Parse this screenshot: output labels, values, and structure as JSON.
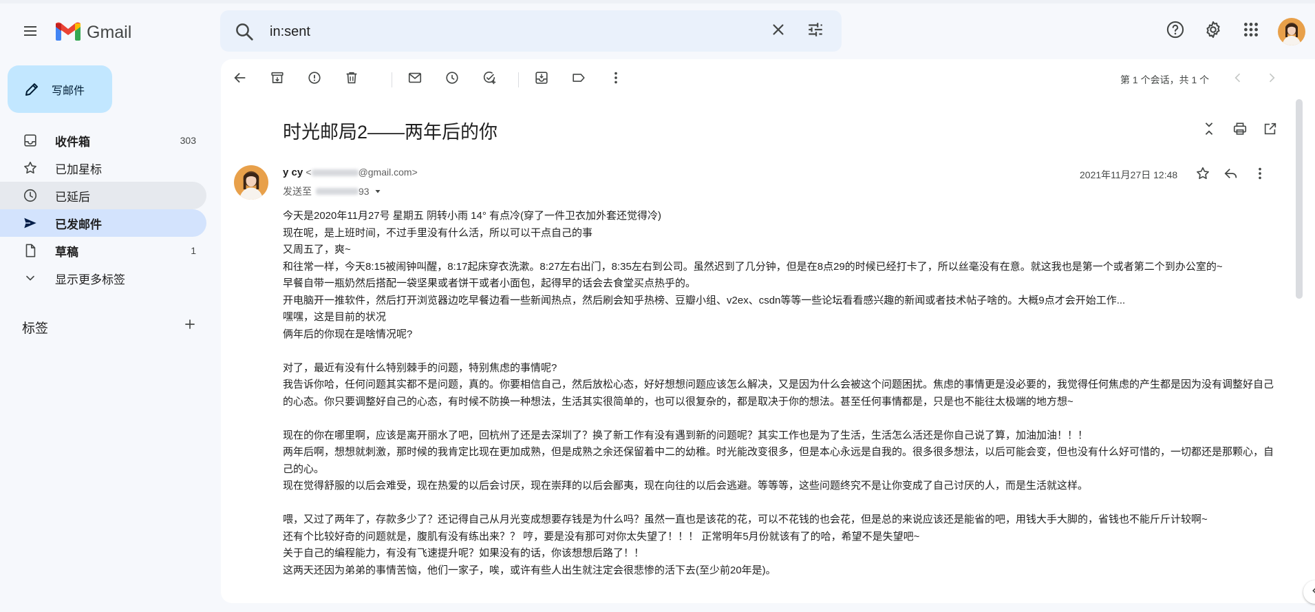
{
  "header": {
    "app_name": "Gmail",
    "search_value": "in:sent",
    "icons": [
      "menu-icon",
      "gmail-logo-icon",
      "search-icon",
      "close-icon",
      "tune-icon",
      "help-icon",
      "gear-icon",
      "apps-grid-icon",
      "avatar"
    ]
  },
  "sidebar": {
    "compose_label": "写邮件",
    "items": [
      {
        "label": "收件箱",
        "count": "303",
        "icon": "inbox-icon",
        "bold": true
      },
      {
        "label": "已加星标",
        "count": "",
        "icon": "star-icon"
      },
      {
        "label": "已延后",
        "count": "",
        "icon": "clock-icon"
      },
      {
        "label": "已发邮件",
        "count": "",
        "icon": "send-icon",
        "bold": true,
        "active": true
      },
      {
        "label": "草稿",
        "count": "1",
        "icon": "draft-icon",
        "bold": true
      },
      {
        "label": "显示更多标签",
        "count": "",
        "icon": "chevron-down-icon"
      }
    ],
    "labels_title": "标签"
  },
  "toolbar": {
    "pager_text": "第 1 个会话，共 1 个",
    "icons": [
      "back-arrow-icon",
      "archive-icon",
      "report-spam-icon",
      "delete-icon",
      "mark-unread-icon",
      "snooze-icon",
      "add-task-icon",
      "move-to-icon",
      "label-icon",
      "more-vert-icon",
      "chevron-left-icon",
      "chevron-right-icon"
    ]
  },
  "email": {
    "subject": "时光邮局2——两年后的你",
    "sender_name": "y cy",
    "sender_email_prefix": "<",
    "sender_email_suffix": "@gmail.com>",
    "to_prefix": "发送至",
    "to_suffix": "93",
    "date": "2021年11月27日 12:48",
    "body": [
      "今天是2020年11月27号  星期五  阴转小雨  14°  有点冷(穿了一件卫衣加外套还觉得冷)",
      "现在呢，是上班时间，不过手里没有什么活，所以可以干点自己的事",
      "又周五了，爽~",
      "和往常一样，今天8:15被闹钟叫醒，8:17起床穿衣洗漱。8:27左右出门，8:35左右到公司。虽然迟到了几分钟，但是在8点29的时候已经打卡了，所以丝毫没有在意。就这我也是第一个或者第二个到办公室的~",
      "早餐自带一瓶奶然后搭配一袋坚果或者饼干或者小面包，起得早的话会去食堂买点热乎的。",
      "开电脑开一推软件，然后打开浏览器边吃早餐边看一些新闻热点，然后刷会知乎热榜、豆瓣小组、v2ex、csdn等等一些论坛看看感兴趣的新闻或者技术帖子啥的。大概9点才会开始工作...",
      "嘿嘿，这是目前的状况",
      "俩年后的你现在是啥情况呢?",
      "",
      "对了，最近有没有什么特别棘手的问题，特别焦虑的事情呢?",
      "我告诉你哈，任何问题其实都不是问题，真的。你要相信自己，然后放松心态，好好想想问题应该怎么解决，又是因为什么会被这个问题困扰。焦虑的事情更是没必要的，我觉得任何焦虑的产生都是因为没有调整好自己的心态。你只要调整好自己的心态，有时候不防换一种想法，生活其实很简单的，也可以很复杂的，都是取决于你的想法。甚至任何事情都是，只是也不能往太极端的地方想~",
      "",
      "现在的你在哪里啊，应该是离开丽水了吧，回杭州了还是去深圳了？换了新工作有没有遇到新的问题呢？其实工作也是为了生活，生活怎么活还是你自己说了算，加油加油！！！",
      "两年后啊，想想就刺激，那时候的我肯定比现在更加成熟，但是成熟之余还保留着中二的幼稚。时光能改变很多，但是本心永远是自我的。很多很多想法，以后可能会变，但也没有什么好可惜的，一切都还是那颗心，自己的心。",
      "现在觉得舒服的以后会难受，现在热爱的以后会讨厌，现在崇拜的以后会鄙夷，现在向往的以后会逃避。等等等，这些问题终究不是让你变成了自己讨厌的人，而是生活就这样。",
      "",
      "喂，又过了两年了，存款多少了？还记得自己从月光变成想要存钱是为什么吗？虽然一直也是该花的花，可以不花钱的也会花，但是总的来说应该还是能省的吧，用钱大手大脚的，省钱也不能斤斤计较啊~",
      "还有个比较好奇的问题就是，腹肌有没有练出来？？ 哼，要是没有那可对你太失望了！！！ 正常明年5月份就该有了的哈，希望不是失望吧~",
      "关于自己的编程能力，有没有飞速提升呢？如果没有的话，你该想想后路了！！",
      "这两天还因为弟弟的事情苦恼，他们一家子，唉，或许有些人出生就注定会很悲惨的活下去(至少前20年是)。"
    ]
  }
}
